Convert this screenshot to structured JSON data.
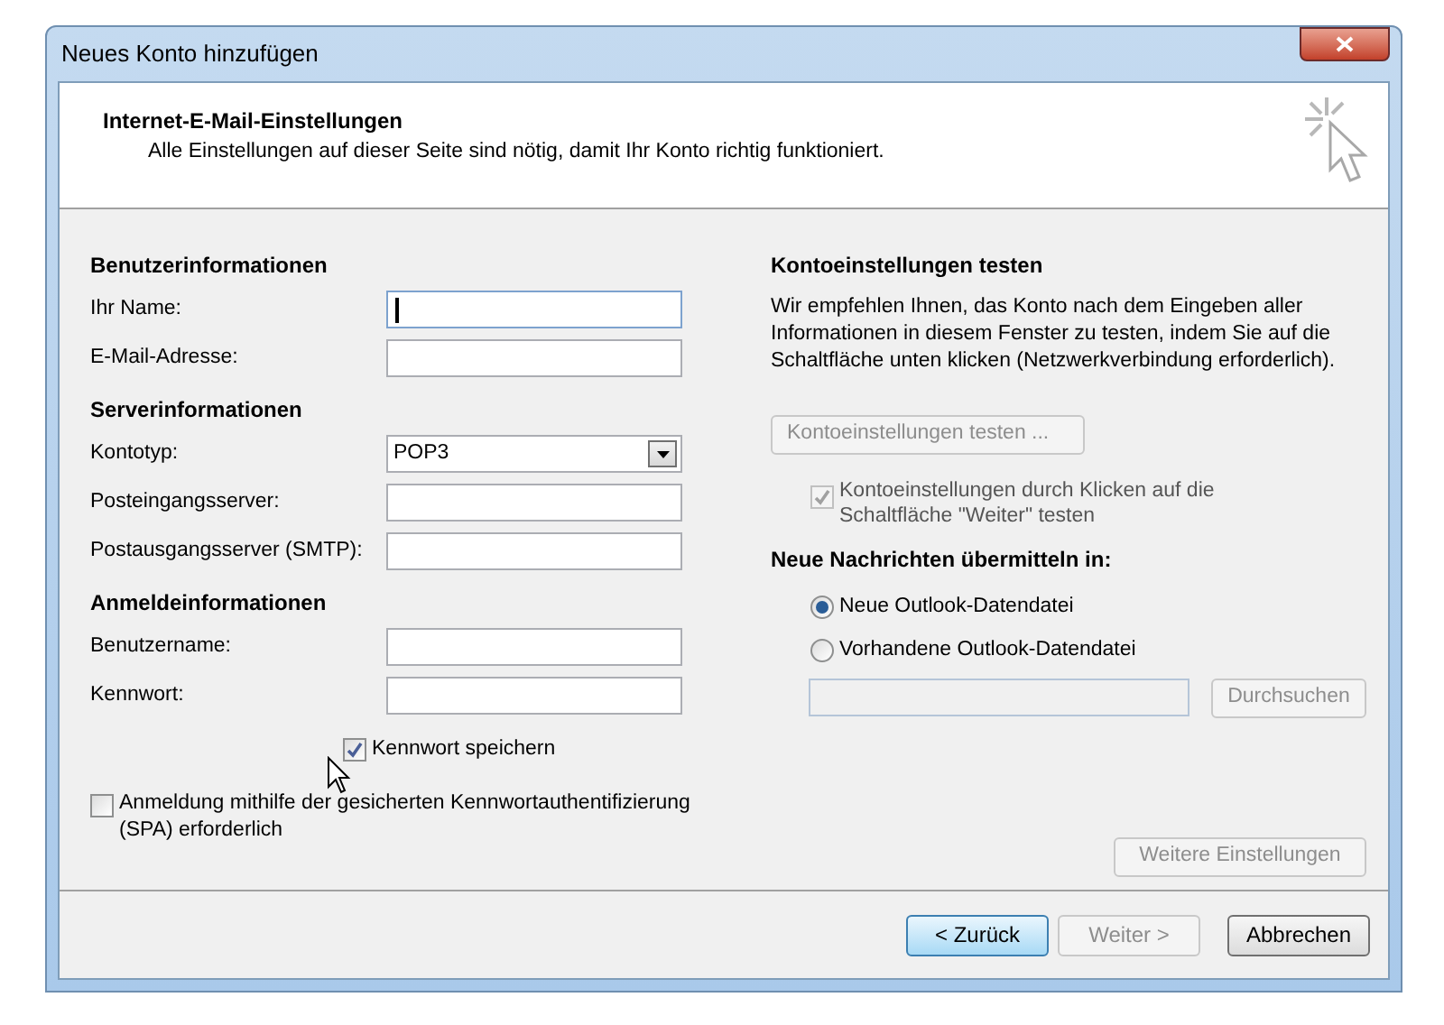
{
  "window": {
    "title": "Neues Konto hinzufügen"
  },
  "header": {
    "title": "Internet-E-Mail-Einstellungen",
    "subtitle": "Alle Einstellungen auf dieser Seite sind nötig, damit Ihr Konto richtig funktioniert."
  },
  "left": {
    "sections": [
      {
        "heading": "Benutzerinformationen",
        "fields": [
          {
            "label": "Ihr Name:",
            "kind": "text",
            "focused": true
          },
          {
            "label": "E-Mail-Adresse:",
            "kind": "text",
            "focused": false
          }
        ]
      },
      {
        "heading": "Serverinformationen",
        "fields": [
          {
            "label": "Kontotyp:",
            "kind": "select",
            "value": "POP3"
          },
          {
            "label": "Posteingangsserver:",
            "kind": "text",
            "focused": false
          },
          {
            "label": "Postausgangsserver (SMTP):",
            "kind": "text",
            "focused": false
          }
        ]
      },
      {
        "heading": "Anmeldeinformationen",
        "fields": [
          {
            "label": "Benutzername:",
            "kind": "text",
            "focused": false
          },
          {
            "label": "Kennwort:",
            "kind": "text",
            "focused": false
          }
        ]
      }
    ],
    "remember_password": {
      "label": "Kennwort speichern",
      "checked": true
    },
    "spa": {
      "label": "Anmeldung mithilfe der gesicherten Kennwortauthentifizierung (SPA) erforderlich",
      "checked": false
    }
  },
  "right": {
    "heading": "Kontoeinstellungen testen",
    "description": "Wir empfehlen Ihnen, das Konto nach dem Eingeben aller Informationen in diesem Fenster zu testen, indem Sie auf die Schaltfläche unten klicken (Netzwerkverbindung erforderlich).",
    "test_button": {
      "label": "Kontoeinstellungen testen ...",
      "disabled": true
    },
    "test_checkbox": {
      "label": "Kontoeinstellungen durch Klicken auf die Schaltfläche \"Weiter\" testen",
      "checked": true,
      "disabled": true
    },
    "delivery_heading": "Neue Nachrichten übermitteln in:",
    "radios": [
      {
        "label": "Neue Outlook-Datendatei",
        "selected": true
      },
      {
        "label": "Vorhandene Outlook-Datendatei",
        "selected": false
      }
    ],
    "browse_button": {
      "label": "Durchsuchen",
      "disabled": true
    },
    "more_button": {
      "label": "Weitere Einstellungen",
      "disabled": true
    }
  },
  "footer": {
    "buttons": [
      {
        "label": "< Zurück",
        "kind": "default"
      },
      {
        "label": "Weiter >",
        "kind": "disabled"
      },
      {
        "label": "Abbrechen",
        "kind": "normal"
      }
    ]
  }
}
